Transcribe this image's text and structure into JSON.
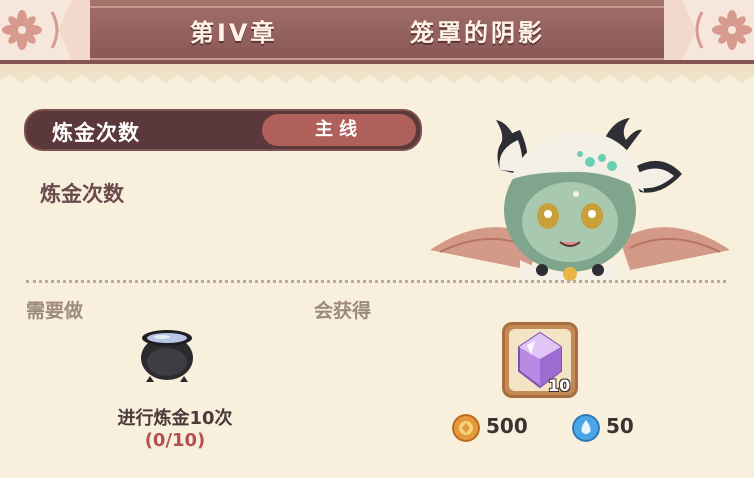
{
  "header": {
    "chapter": "第IV章",
    "title": "笼罩的阴影"
  },
  "quest": {
    "name": "炼金次数",
    "tag": "主线",
    "description": "炼金次数"
  },
  "requirements": {
    "heading": "需要做",
    "task": "进行炼金10次",
    "progress": "(0/10)",
    "icon": "cauldron-icon"
  },
  "rewards": {
    "heading": "会获得",
    "item": {
      "icon": "crystal-icon",
      "count": "10"
    },
    "currencies": [
      {
        "icon": "gold-coin-icon",
        "amount": "500",
        "color": "#e39a3c"
      },
      {
        "icon": "blue-drop-icon",
        "amount": "50",
        "color": "#4aa7e6"
      }
    ]
  },
  "colors": {
    "header": "#8f5e5b",
    "pill": "#5b3839",
    "tag": "#b0605a",
    "progress": "#b5514d",
    "background": "#f8f0dc"
  }
}
